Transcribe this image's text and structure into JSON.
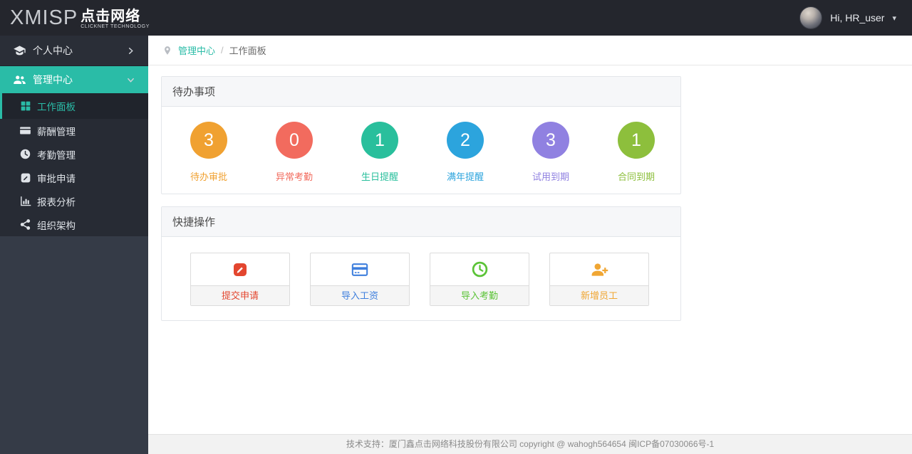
{
  "colors": {
    "accent": "#2abca7",
    "header_bg": "#24262d",
    "sidebar_bg": "#353b47"
  },
  "header": {
    "logo_main": "XMISP",
    "logo_cn": "点击网络",
    "logo_sub": "CLICKNET TECHNOLOGY",
    "user_greeting": "Hi, HR_user",
    "caret": "▾"
  },
  "sidebar": {
    "items": [
      {
        "label": "个人中心",
        "icon": "graduation-cap-icon",
        "state": "collapsed"
      },
      {
        "label": "管理中心",
        "icon": "users-icon",
        "state": "expanded"
      }
    ],
    "submenu": [
      {
        "label": "工作面板",
        "icon": "grid-icon",
        "active": true
      },
      {
        "label": "薪酬管理",
        "icon": "credit-card-icon",
        "active": false
      },
      {
        "label": "考勤管理",
        "icon": "clock-icon",
        "active": false
      },
      {
        "label": "审批申请",
        "icon": "pencil-square-icon",
        "active": false
      },
      {
        "label": "报表分析",
        "icon": "bar-chart-icon",
        "active": false
      },
      {
        "label": "组织架构",
        "icon": "org-nodes-icon",
        "active": false
      }
    ]
  },
  "breadcrumb": {
    "parent": "管理中心",
    "separator": "/",
    "current": "工作面板"
  },
  "todo_panel": {
    "title": "待办事项",
    "items": [
      {
        "count": "3",
        "label": "待办审批",
        "color": "#f0a131"
      },
      {
        "count": "0",
        "label": "异常考勤",
        "color": "#f26b5e"
      },
      {
        "count": "1",
        "label": "生日提醒",
        "color": "#29bf9c"
      },
      {
        "count": "2",
        "label": "满年提醒",
        "color": "#2ca4dd"
      },
      {
        "count": "3",
        "label": "试用到期",
        "color": "#9081e1"
      },
      {
        "count": "1",
        "label": "合同到期",
        "color": "#8dbf3c"
      }
    ]
  },
  "quick_panel": {
    "title": "快捷操作",
    "actions": [
      {
        "label": "提交申请",
        "icon": "pencil-square-icon",
        "color": "#e3462f"
      },
      {
        "label": "导入工资",
        "icon": "credit-card-icon",
        "color": "#3e7fdd"
      },
      {
        "label": "导入考勤",
        "icon": "clock-icon",
        "color": "#5bc337"
      },
      {
        "label": "新增员工",
        "icon": "user-plus-icon",
        "color": "#f0a633"
      }
    ]
  },
  "footer": {
    "text": "技术支持：厦门鑫点击网络科技股份有限公司  copyright @ wahogh564654  闽ICP备07030066号-1"
  }
}
